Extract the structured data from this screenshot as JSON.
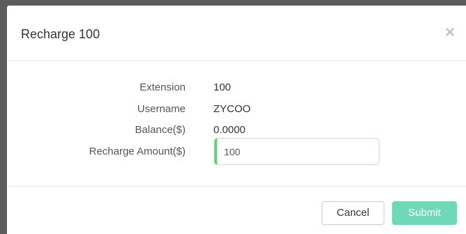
{
  "modal": {
    "title": "Recharge 100",
    "close_glyph": "×"
  },
  "fields": {
    "extension": {
      "label": "Extension",
      "value": "100"
    },
    "username": {
      "label": "Username",
      "value": "ZYCOO"
    },
    "balance": {
      "label": "Balance($)",
      "value": "0.0000"
    },
    "recharge_amount": {
      "label": "Recharge Amount($)",
      "value": "100",
      "placeholder": ""
    }
  },
  "footer": {
    "cancel_label": "Cancel",
    "submit_label": "Submit"
  },
  "colors": {
    "submit_button": "#6fd9b7",
    "input_focus_accent": "#5cd67a",
    "backdrop": "#5c5c5c"
  }
}
